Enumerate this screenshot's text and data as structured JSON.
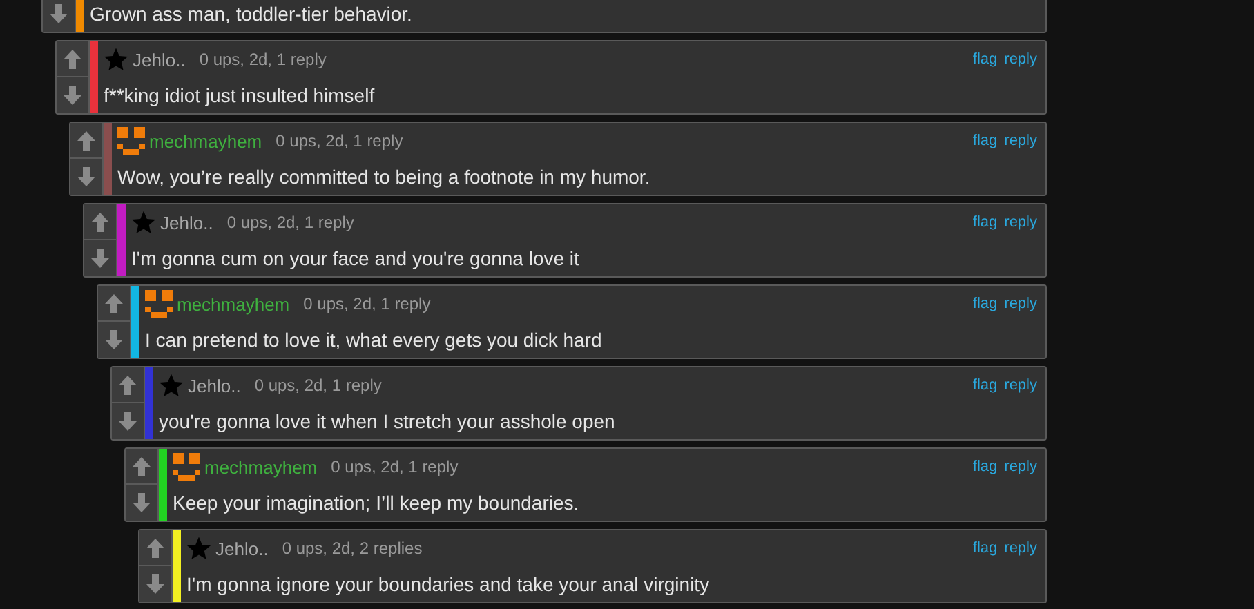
{
  "thread": {
    "kind": "cut",
    "text": "Grown ass man, toddler-tier behavior.",
    "color": "#f08a00",
    "children": [
      {
        "kind": "full",
        "avatar": {
          "kind": "star"
        },
        "user": {
          "name": "Jehlo..",
          "color": "#a8a8a8"
        },
        "meta": "0 ups, 2d, 1 reply",
        "text": "f**king idiot just insulted himself",
        "color": "#e8323c",
        "flag": "flag",
        "reply": "reply",
        "children": [
          {
            "kind": "full",
            "avatar": {
              "kind": "smiley"
            },
            "user": {
              "name": "mechmayhem",
              "color": "#3fb13f"
            },
            "meta": "0 ups, 2d, 1 reply",
            "text": "Wow, you’re really committed to being a footnote in my humor.",
            "color": "#8a4e4e",
            "flag": "flag",
            "reply": "reply",
            "children": [
              {
                "kind": "full",
                "avatar": {
                  "kind": "star"
                },
                "user": {
                  "name": "Jehlo..",
                  "color": "#a8a8a8"
                },
                "meta": "0 ups, 2d, 1 reply",
                "text": "I'm gonna cum on your face and you're gonna love it",
                "color": "#c21cc2",
                "flag": "flag",
                "reply": "reply",
                "children": [
                  {
                    "kind": "full",
                    "avatar": {
                      "kind": "smiley"
                    },
                    "user": {
                      "name": "mechmayhem",
                      "color": "#3fb13f"
                    },
                    "meta": "0 ups, 2d, 1 reply",
                    "text": "I can pretend to love it, what every gets you dick hard",
                    "color": "#12b6e2",
                    "flag": "flag",
                    "reply": "reply",
                    "children": [
                      {
                        "kind": "full",
                        "avatar": {
                          "kind": "star"
                        },
                        "user": {
                          "name": "Jehlo..",
                          "color": "#a8a8a8"
                        },
                        "meta": "0 ups, 2d, 1 reply",
                        "text": "you're gonna love it when I stretch your asshole open",
                        "color": "#3232d4",
                        "flag": "flag",
                        "reply": "reply",
                        "children": [
                          {
                            "kind": "full",
                            "avatar": {
                              "kind": "smiley"
                            },
                            "user": {
                              "name": "mechmayhem",
                              "color": "#3fb13f"
                            },
                            "meta": "0 ups, 2d, 1 reply",
                            "text": "Keep your imagination; I’ll keep my boundaries.",
                            "color": "#22d422",
                            "flag": "flag",
                            "reply": "reply",
                            "children": [
                              {
                                "kind": "full",
                                "avatar": {
                                  "kind": "star"
                                },
                                "user": {
                                  "name": "Jehlo..",
                                  "color": "#a8a8a8"
                                },
                                "meta": "0 ups, 2d, 2 replies",
                                "text": "I'm gonna ignore your boundaries and take your anal virginity",
                                "color": "#f2f022",
                                "flag": "flag",
                                "reply": "reply"
                              }
                            ]
                          }
                        ]
                      }
                    ]
                  }
                ]
              }
            ]
          }
        ]
      }
    ]
  }
}
